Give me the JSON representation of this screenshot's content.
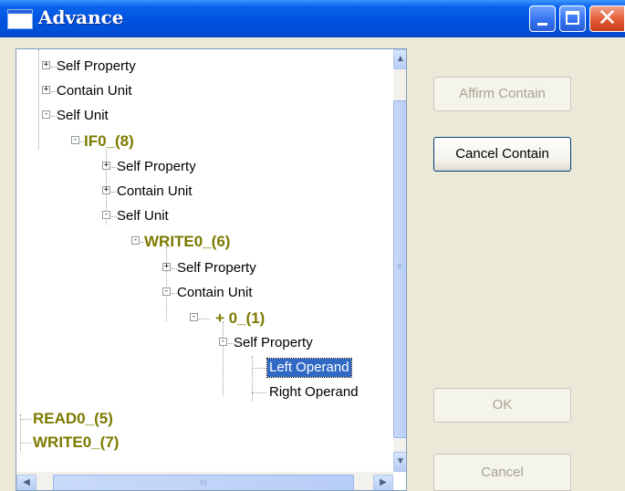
{
  "window": {
    "title": "Advance"
  },
  "tree": {
    "nodes": [
      {
        "label": "Self Property",
        "toggle": "+"
      },
      {
        "label": "Contain Unit",
        "toggle": "+"
      },
      {
        "label": "Self Unit",
        "toggle": "-"
      },
      {
        "label": "IF0_(8)",
        "toggle": "-"
      },
      {
        "label": "Self Property",
        "toggle": "+"
      },
      {
        "label": "Contain Unit",
        "toggle": "+"
      },
      {
        "label": "Self Unit",
        "toggle": "-"
      },
      {
        "label": "WRITE0_(6)",
        "toggle": "-"
      },
      {
        "label": "Self Property",
        "toggle": "+"
      },
      {
        "label": "Contain Unit",
        "toggle": "-"
      },
      {
        "label": "+ 0_(1)",
        "toggle": "-"
      },
      {
        "label": "Self Property",
        "toggle": "-"
      },
      {
        "label": "Left Operand",
        "toggle": ""
      },
      {
        "label": "Right Operand",
        "toggle": ""
      },
      {
        "label": "READ0_(5)",
        "toggle": ""
      },
      {
        "label": "WRITE0_(7)",
        "toggle": ""
      }
    ]
  },
  "buttons": {
    "affirm": "Affirm Contain",
    "cancel_contain": "Cancel Contain",
    "ok": "OK",
    "cancel": "Cancel"
  },
  "scroll_glyphs": {
    "up": "▲",
    "down": "▼",
    "left": "◀",
    "right": "▶",
    "grip": "≡",
    "hgrip": "III"
  },
  "caption_glyphs": {
    "close": "✕"
  },
  "colors": {
    "unit_label": "#7c7a00",
    "selection": "#316ac5",
    "title_bar": "#0053e1"
  }
}
